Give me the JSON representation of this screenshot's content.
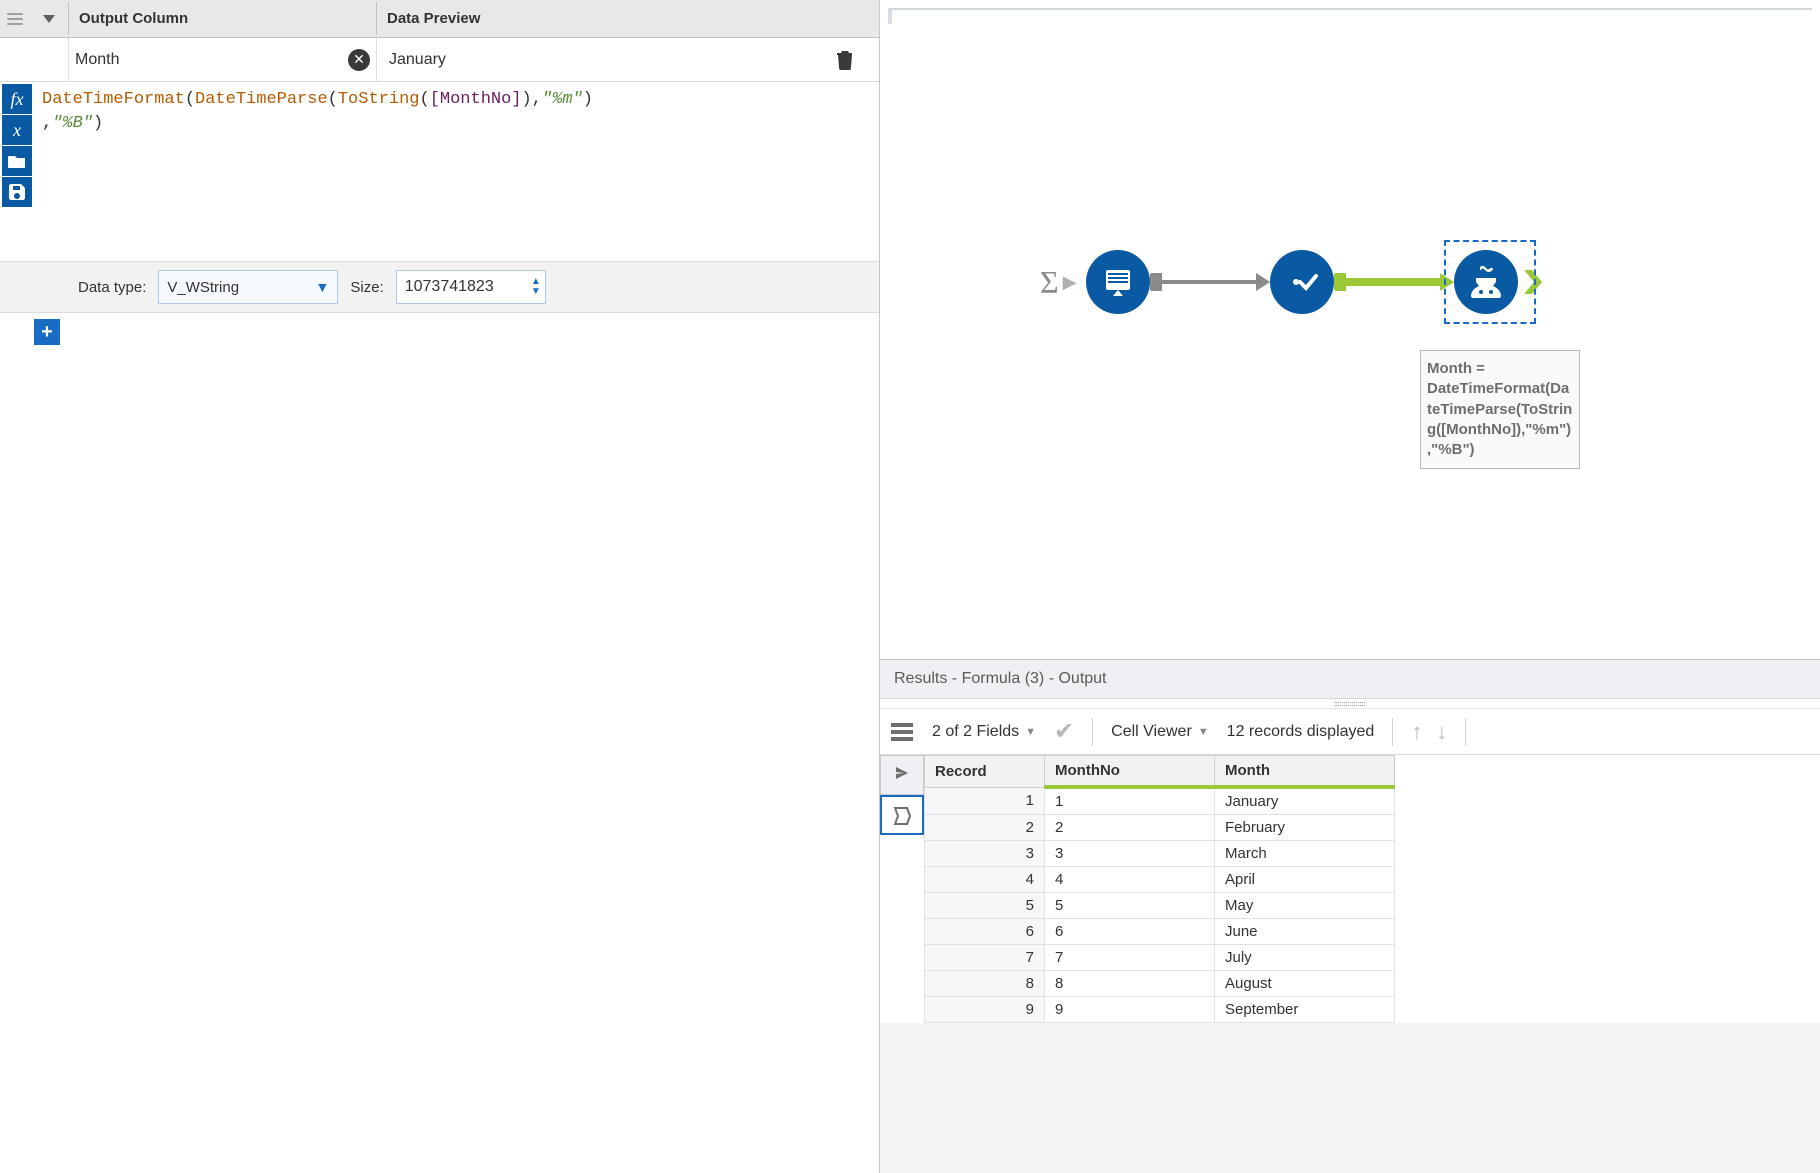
{
  "leftPanel": {
    "headers": {
      "output": "Output Column",
      "preview": "Data Preview"
    },
    "outputColumn": "Month",
    "previewValue": "January",
    "formula_tokens": [
      {
        "t": "fn",
        "v": "DateTimeFormat"
      },
      {
        "t": "p",
        "v": "("
      },
      {
        "t": "fn",
        "v": "DateTimeParse"
      },
      {
        "t": "p",
        "v": "("
      },
      {
        "t": "fn",
        "v": "ToString"
      },
      {
        "t": "p",
        "v": "("
      },
      {
        "t": "field",
        "v": "[MonthNo]"
      },
      {
        "t": "p",
        "v": "),"
      },
      {
        "t": "str",
        "v": "\"%m\""
      },
      {
        "t": "p",
        "v": ")\n,"
      },
      {
        "t": "str",
        "v": "\"%B\""
      },
      {
        "t": "p",
        "v": ")"
      }
    ],
    "dataTypeLabel": "Data type:",
    "dataTypeValue": "V_WString",
    "sizeLabel": "Size:",
    "sizeValue": "1073741823",
    "toolButtons": [
      "fx",
      "x",
      "open",
      "save"
    ]
  },
  "canvas": {
    "nodeLabel": "Month = DateTimeFormat(DateTimeParse(ToString([MonthNo]),\"%m\"),\"%B\")"
  },
  "results": {
    "title": "Results - Formula (3) - Output",
    "fieldsText": "2 of 2 Fields",
    "cellViewer": "Cell Viewer",
    "recordsText": "12 records displayed",
    "columns": [
      "Record",
      "MonthNo",
      "Month"
    ],
    "rows": [
      {
        "rec": "1",
        "no": "1",
        "m": "January"
      },
      {
        "rec": "2",
        "no": "2",
        "m": "February"
      },
      {
        "rec": "3",
        "no": "3",
        "m": "March"
      },
      {
        "rec": "4",
        "no": "4",
        "m": "April"
      },
      {
        "rec": "5",
        "no": "5",
        "m": "May"
      },
      {
        "rec": "6",
        "no": "6",
        "m": "June"
      },
      {
        "rec": "7",
        "no": "7",
        "m": "July"
      },
      {
        "rec": "8",
        "no": "8",
        "m": "August"
      },
      {
        "rec": "9",
        "no": "9",
        "m": "September"
      }
    ]
  }
}
